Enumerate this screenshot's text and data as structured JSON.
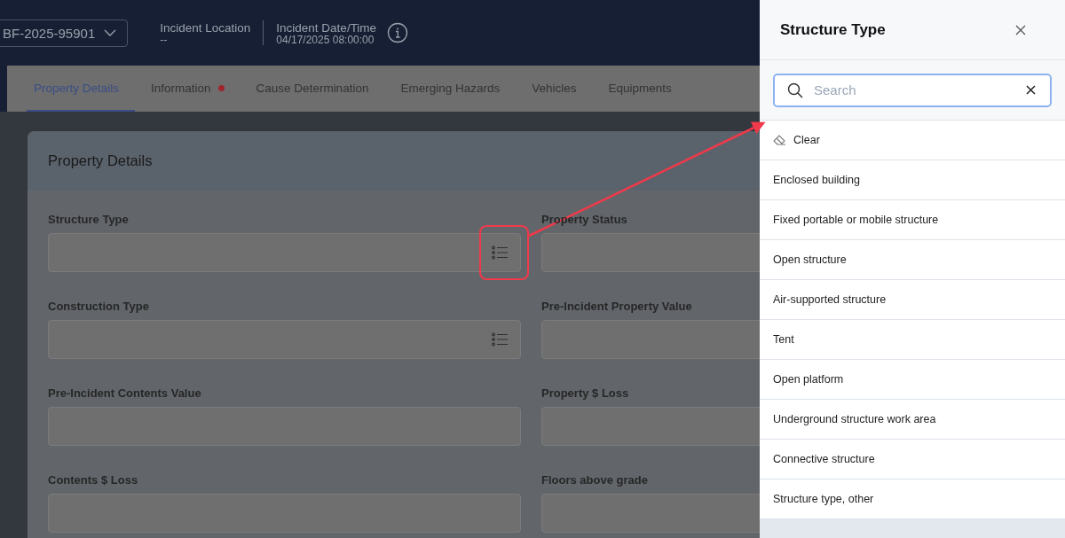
{
  "header": {
    "case_number": "BF-2025-95901",
    "location": {
      "label": "Incident Location",
      "value": "--"
    },
    "date_time": {
      "label": "Incident Date/Time",
      "value": "04/17/2025 08:00:00"
    }
  },
  "tabs": [
    {
      "label": "Property Details",
      "selected": true,
      "alert": false
    },
    {
      "label": "Information",
      "selected": false,
      "alert": true
    },
    {
      "label": "Cause Determination",
      "selected": false,
      "alert": false
    },
    {
      "label": "Emerging Hazards",
      "selected": false,
      "alert": false
    },
    {
      "label": "Vehicles",
      "selected": false,
      "alert": false
    },
    {
      "label": "Equipments",
      "selected": false,
      "alert": false
    }
  ],
  "card": {
    "title": "Property Details",
    "fields": [
      {
        "label": "Structure Type",
        "kind": "picker",
        "highlighted": true
      },
      {
        "label": "Property Status",
        "kind": "text",
        "highlighted": false
      },
      {
        "label": "Construction Type",
        "kind": "picker",
        "highlighted": false
      },
      {
        "label": "Pre-Incident Property Value",
        "kind": "text",
        "highlighted": false
      },
      {
        "label": "Pre-Incident Contents Value",
        "kind": "text",
        "highlighted": false
      },
      {
        "label": "Property $ Loss",
        "kind": "text",
        "highlighted": false
      },
      {
        "label": "Contents $ Loss",
        "kind": "text",
        "highlighted": false
      },
      {
        "label": "Floors above grade",
        "kind": "text",
        "highlighted": false
      }
    ]
  },
  "drawer": {
    "title": "Structure Type",
    "search": {
      "placeholder": "Search"
    },
    "items": [
      {
        "label": "Clear",
        "kind": "clear"
      },
      {
        "label": "Enclosed building",
        "kind": "option"
      },
      {
        "label": "Fixed portable or mobile structure",
        "kind": "option"
      },
      {
        "label": "Open structure",
        "kind": "option"
      },
      {
        "label": "Air-supported structure",
        "kind": "option"
      },
      {
        "label": "Tent",
        "kind": "option"
      },
      {
        "label": "Open platform",
        "kind": "option"
      },
      {
        "label": "Underground structure work area",
        "kind": "option"
      },
      {
        "label": "Connective structure",
        "kind": "option"
      },
      {
        "label": "Structure type, other",
        "kind": "option"
      }
    ]
  }
}
